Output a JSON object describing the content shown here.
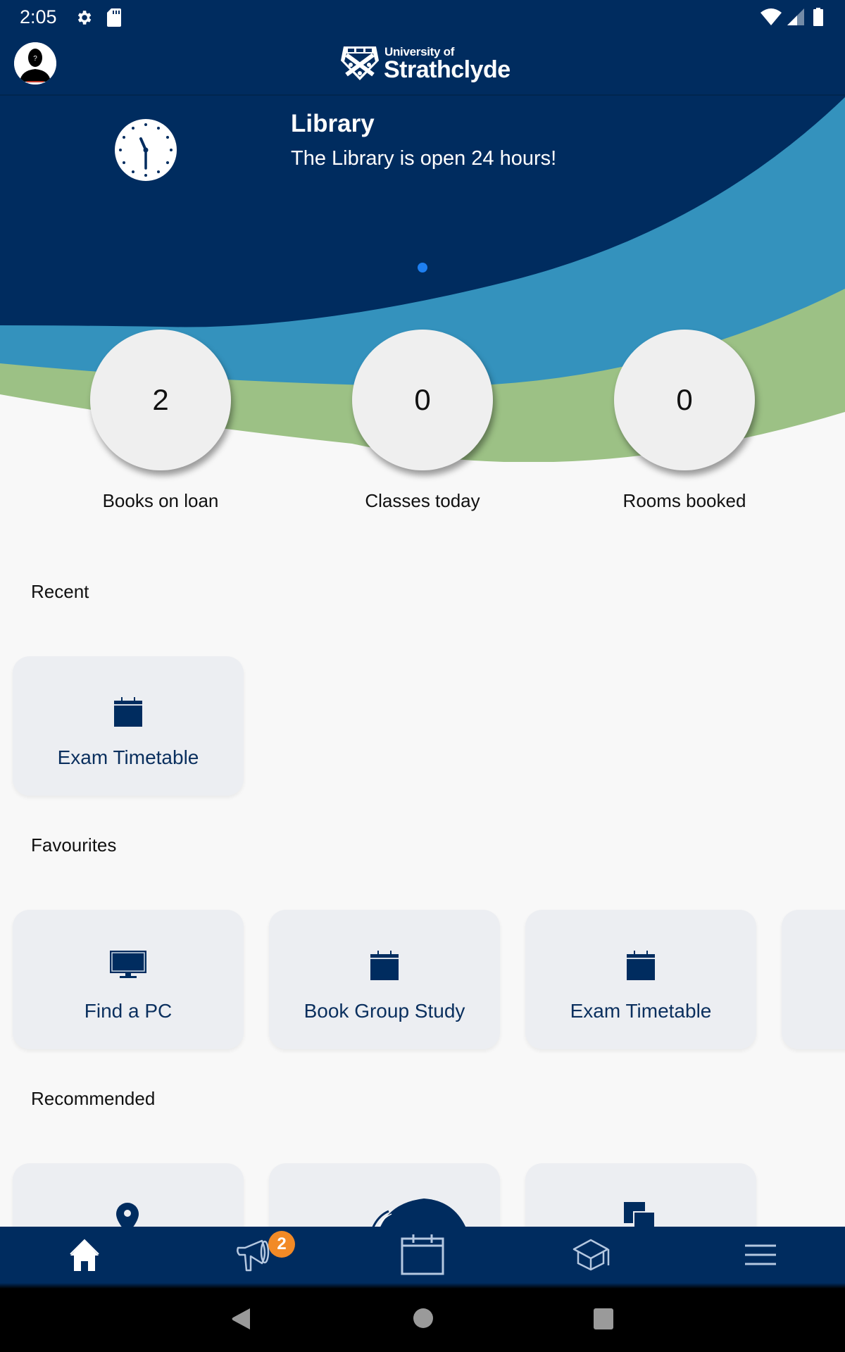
{
  "status_bar": {
    "time": "2:05",
    "icons": [
      "settings-icon",
      "sd-card-icon",
      "wifi-icon",
      "cell-signal-icon",
      "battery-icon"
    ]
  },
  "header": {
    "logo_line1": "University of",
    "logo_line2": "Strathclyde"
  },
  "banner": {
    "title": "Library",
    "text": "The Library is open 24 hours!",
    "icon": "clock-icon",
    "page_count": 1,
    "active_page": 1
  },
  "stats": [
    {
      "value": "2",
      "label": "Books on loan"
    },
    {
      "value": "0",
      "label": "Classes today"
    },
    {
      "value": "0",
      "label": "Rooms booked"
    }
  ],
  "sections": {
    "recent": {
      "title": "Recent",
      "items": [
        {
          "label": "Exam Timetable",
          "icon": "calendar-icon"
        }
      ]
    },
    "favourites": {
      "title": "Favourites",
      "items": [
        {
          "label": "Find a PC",
          "icon": "monitor-icon"
        },
        {
          "label": "Book Group Study",
          "icon": "calendar-icon"
        },
        {
          "label": "Exam Timetable",
          "icon": "calendar-icon"
        },
        {
          "label": "",
          "icon": ""
        }
      ]
    },
    "recommended": {
      "title": "Recommended",
      "items": [
        {
          "label": "",
          "icon": "map-pin-icon"
        },
        {
          "label": "",
          "icon": "dome-icon"
        },
        {
          "label": "",
          "icon": "copy-icon"
        }
      ]
    }
  },
  "bottom_nav": {
    "items": [
      {
        "name": "home",
        "icon": "home-icon",
        "active": true
      },
      {
        "name": "announcements",
        "icon": "megaphone-icon",
        "badge": "2"
      },
      {
        "name": "timetable",
        "icon": "calendar-icon"
      },
      {
        "name": "learning",
        "icon": "graduation-cap-icon"
      },
      {
        "name": "menu",
        "icon": "menu-icon"
      }
    ]
  },
  "colors": {
    "navy": "#002c5f",
    "blue_band": "#3492bd",
    "green_band": "#9cc185",
    "background": "#f8f8f8",
    "card": "#eceef2",
    "badge": "#f28a26",
    "dot_active": "#1e7ff0"
  }
}
